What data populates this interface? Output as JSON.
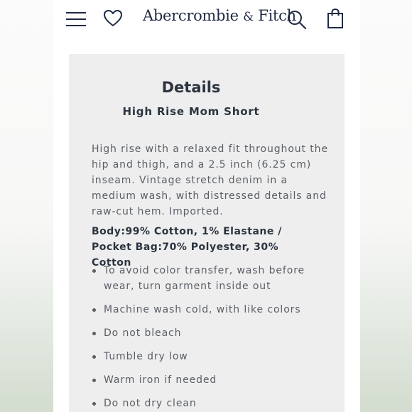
{
  "header": {
    "brand_main": "Abercrombie",
    "brand_amp": "&",
    "brand_tail": "Fitch",
    "icons": [
      "menu-icon",
      "heart-icon",
      "search-icon",
      "shopping-bag-icon"
    ]
  },
  "details": {
    "title": "Details",
    "product_name": "High Rise Mom Short",
    "description": "High rise with a relaxed fit throughout the hip and thigh, and a 2.5 inch (6.25 cm) inseam. Vintage stretch denim in a medium wash, with distressed details and raw-cut hem. Imported.",
    "fabric": "Body:99% Cotton, 1% Elastane / Pocket Bag:70% Polyester, 30% Cotton",
    "care": [
      "To avoid color transfer, wash before wear, turn garment inside out",
      "Machine wash cold, with like colors",
      "Do not bleach",
      "Tumble dry low",
      "Warm iron if needed",
      "Do not dry clean"
    ]
  },
  "colors": {
    "brand_navy": "#1f2a44",
    "card_background": "#eeeeee",
    "body_text": "#5a5f66",
    "heading_text": "#2b3440"
  }
}
